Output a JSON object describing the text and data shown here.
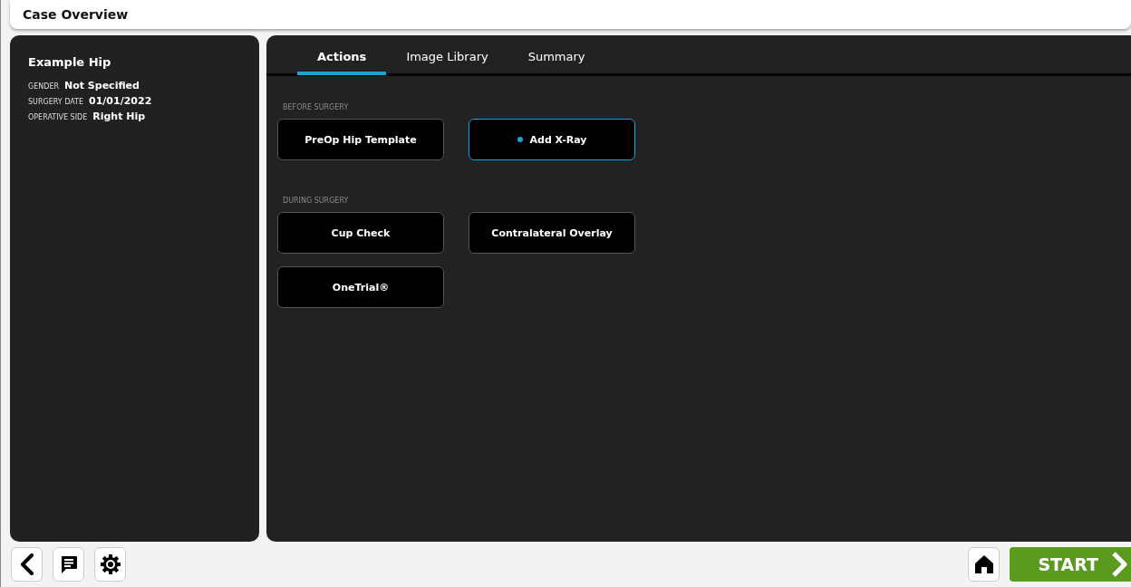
{
  "window": {
    "title": "Case Overview"
  },
  "patient": {
    "name": "Example Hip",
    "fields": [
      {
        "label": "GENDER",
        "value": "Not Specified"
      },
      {
        "label": "SURGERY DATE",
        "value": "01/01/2022"
      },
      {
        "label": "OPERATIVE SIDE",
        "value": "Right Hip"
      }
    ]
  },
  "tabs": [
    {
      "label": "Actions",
      "selected": true
    },
    {
      "label": "Image Library",
      "selected": false
    },
    {
      "label": "Summary",
      "selected": false
    }
  ],
  "sections": [
    {
      "heading": "BEFORE SURGERY",
      "actions": [
        {
          "label": "PreOp Hip Template",
          "selected": false
        },
        {
          "label": "Add X-Ray",
          "selected": true
        }
      ]
    },
    {
      "heading": "DURING SURGERY",
      "actions": [
        {
          "label": "Cup Check",
          "selected": false
        },
        {
          "label": "Contralateral Overlay",
          "selected": false
        },
        {
          "label": "OneTrial®",
          "selected": false
        }
      ]
    }
  ],
  "start_button": {
    "label": "START"
  }
}
